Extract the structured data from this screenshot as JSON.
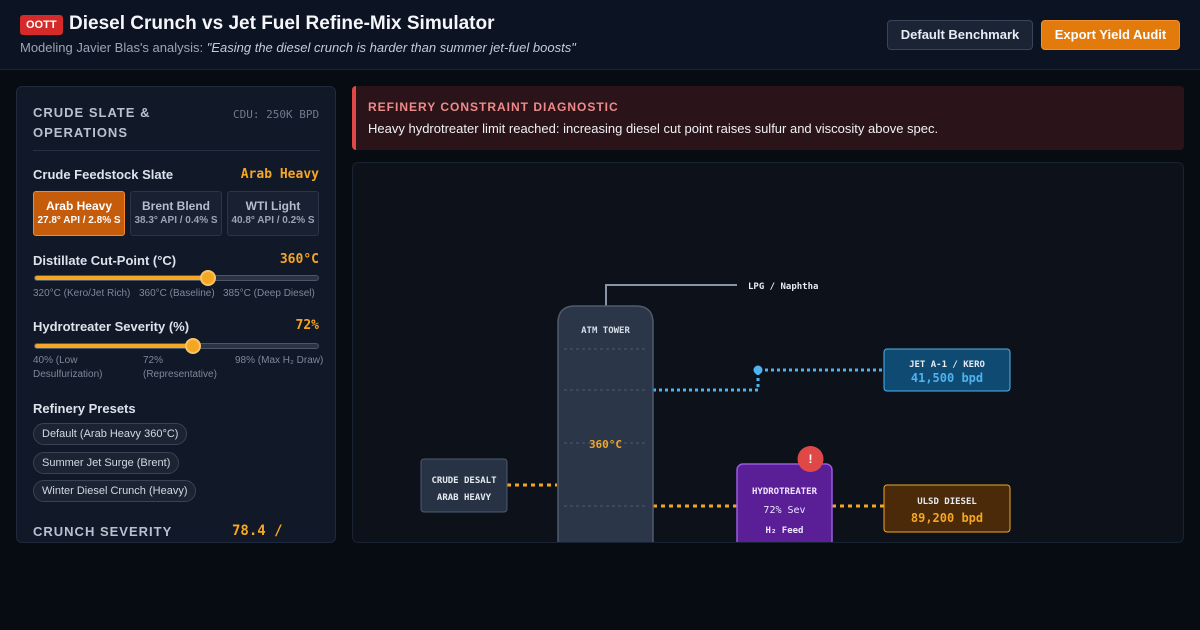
{
  "header": {
    "badge": "OOTT",
    "title": "Diesel Crunch vs Jet Fuel Refine-Mix Simulator",
    "subtitle_prefix": "Modeling Javier Blas's analysis: ",
    "subtitle_quote": "\"Easing the diesel crunch is harder than summer jet-fuel boosts\"",
    "default_button": "Default Benchmark",
    "export_button": "Export Yield Audit"
  },
  "panel": {
    "title": "CRUDE SLATE & OPERATIONS",
    "capacity": "CDU: 250K BPD",
    "feedstock": {
      "label": "Crude Feedstock Slate",
      "value": "Arab Heavy",
      "options": [
        {
          "name": "Arab Heavy",
          "spec": "27.8° API / 2.8% S",
          "active": true
        },
        {
          "name": "Brent Blend",
          "spec": "38.3° API / 0.4% S",
          "active": false
        },
        {
          "name": "WTI Light",
          "spec": "40.8° API / 0.2% S",
          "active": false
        }
      ]
    },
    "cut_point": {
      "label": "Distillate Cut-Point (°C)",
      "value": "360°C",
      "level_pct": 61,
      "ticks": [
        "320°C (Kero/Jet Rich)",
        "360°C (Baseline)",
        "385°C (Deep Diesel)"
      ]
    },
    "severity": {
      "label": "Hydrotreater Severity (%)",
      "value": "72%",
      "level_pct": 56,
      "ticks": [
        "40% (Low Desulfurization)",
        "72% (Representative)",
        "98% (Max H₂ Draw)"
      ]
    },
    "presets": {
      "label": "Refinery Presets",
      "items": [
        "Default (Arab Heavy 360°C)",
        "Summer Jet Surge (Brent)",
        "Winter Diesel Crunch (Heavy)"
      ]
    },
    "crunch": {
      "label": "CRUNCH SEVERITY",
      "value": "78.4 /"
    }
  },
  "alert": {
    "title": "REFINERY CONSTRAINT DIAGNOSTIC",
    "body": "Heavy hydrotreater limit reached: increasing diesel cut point raises sulfur and viscosity above spec."
  },
  "schematic": {
    "desalter": {
      "line1": "CRUDE DESALT",
      "line2": "ARAB HEAVY"
    },
    "tower": {
      "label": "ATM TOWER",
      "cut_point": "360°C"
    },
    "lpg_label": "LPG / Naphtha",
    "jet": {
      "label": "JET A-1 / KERO",
      "value": "41,500 bpd"
    },
    "hydrotreater": {
      "label": "HYDROTREATER",
      "severity": "72% Sev",
      "feed": "H₂ Feed",
      "warning": "!"
    },
    "diesel": {
      "label": "ULSD DIESEL",
      "value": "89,200 bpd"
    },
    "colors": {
      "jet": "#4fb3f0",
      "diesel": "#f5a623",
      "alert": "#e04848",
      "hydrotreater": "#6a2aa8"
    }
  }
}
